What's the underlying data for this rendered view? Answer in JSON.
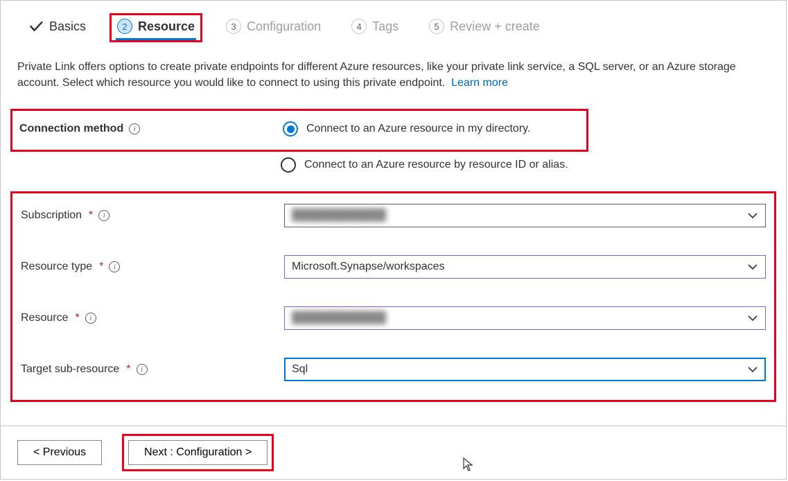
{
  "tabs": {
    "t1": {
      "label": "Basics"
    },
    "t2": {
      "num": "2",
      "label": "Resource"
    },
    "t3": {
      "num": "3",
      "label": "Configuration"
    },
    "t4": {
      "num": "4",
      "label": "Tags"
    },
    "t5": {
      "num": "5",
      "label": "Review + create"
    }
  },
  "desc": {
    "text": "Private Link offers options to create private endpoints for different Azure resources, like your private link service, a SQL server, or an Azure storage account. Select which resource you would like to connect to using this private endpoint.",
    "learnmore": "Learn more"
  },
  "connection": {
    "label": "Connection method",
    "opt1": "Connect to an Azure resource in my directory.",
    "opt2": "Connect to an Azure resource by resource ID or alias."
  },
  "fields": {
    "subscription": {
      "label": "Subscription",
      "value": "████████████"
    },
    "resourcetype": {
      "label": "Resource type",
      "value": "Microsoft.Synapse/workspaces"
    },
    "resource": {
      "label": "Resource",
      "value": "████████████"
    },
    "targetsub": {
      "label": "Target sub-resource",
      "value": "Sql"
    }
  },
  "footer": {
    "prev": "< Previous",
    "next": "Next : Configuration >"
  }
}
